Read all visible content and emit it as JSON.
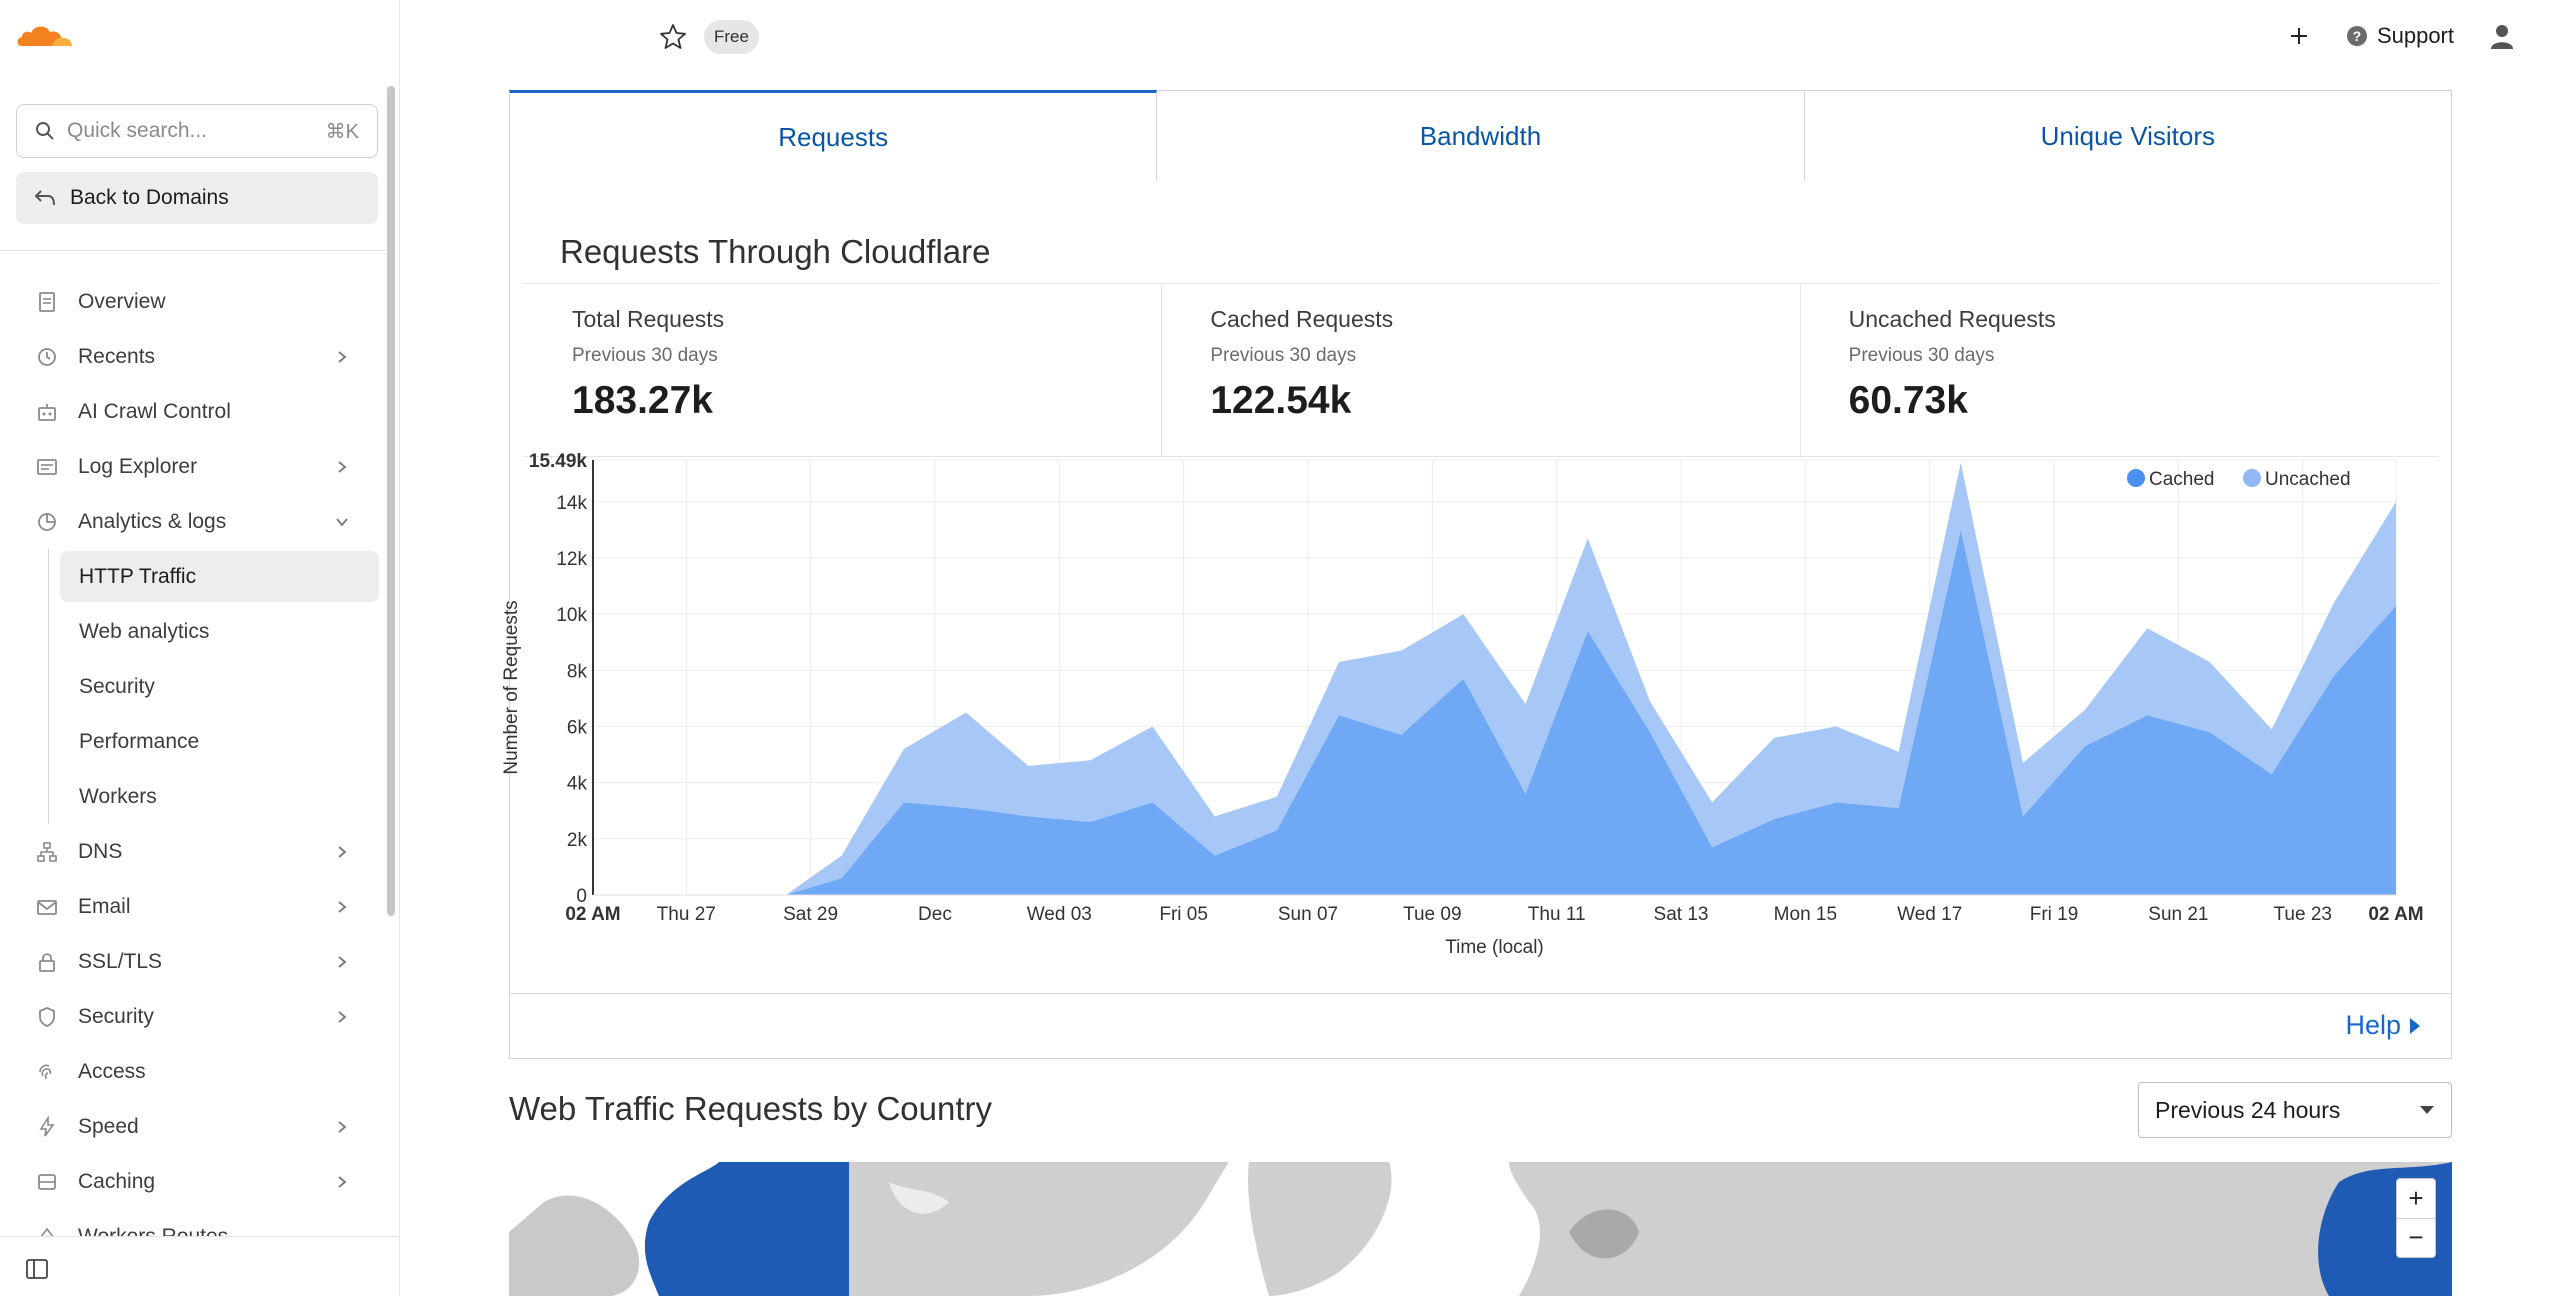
{
  "header": {
    "plan_badge": "Free",
    "support_label": "Support"
  },
  "sidebar": {
    "search_placeholder": "Quick search...",
    "search_shortcut": "⌘K",
    "back_label": "Back to Domains",
    "items": [
      {
        "label": "Overview",
        "icon": "document-icon",
        "chevron": false
      },
      {
        "label": "Recents",
        "icon": "clock-icon",
        "chevron": true
      },
      {
        "label": "AI Crawl Control",
        "icon": "robot-icon",
        "chevron": false
      },
      {
        "label": "Log Explorer",
        "icon": "log-icon",
        "chevron": true
      },
      {
        "label": "Analytics & logs",
        "icon": "pie-chart-icon",
        "chevron": true,
        "expanded": true
      }
    ],
    "sub_items": [
      {
        "label": "HTTP Traffic",
        "active": true
      },
      {
        "label": "Web analytics"
      },
      {
        "label": "Security"
      },
      {
        "label": "Performance"
      },
      {
        "label": "Workers"
      }
    ],
    "items_after": [
      {
        "label": "DNS",
        "icon": "network-icon",
        "chevron": true
      },
      {
        "label": "Email",
        "icon": "envelope-icon",
        "chevron": true
      },
      {
        "label": "SSL/TLS",
        "icon": "lock-icon",
        "chevron": true
      },
      {
        "label": "Security",
        "icon": "shield-icon",
        "chevron": true
      },
      {
        "label": "Access",
        "icon": "access-icon",
        "chevron": false
      },
      {
        "label": "Speed",
        "icon": "lightning-icon",
        "chevron": true
      },
      {
        "label": "Caching",
        "icon": "cache-icon",
        "chevron": true
      },
      {
        "label": "Workers Routes",
        "icon": "workers-icon",
        "chevron": false
      }
    ]
  },
  "tabs": [
    {
      "label": "Requests",
      "active": true
    },
    {
      "label": "Bandwidth"
    },
    {
      "label": "Unique Visitors"
    }
  ],
  "card": {
    "title": "Requests Through Cloudflare",
    "stats": [
      {
        "label": "Total Requests",
        "sub": "Previous 30 days",
        "value": "183.27k"
      },
      {
        "label": "Cached Requests",
        "sub": "Previous 30 days",
        "value": "122.54k"
      },
      {
        "label": "Uncached Requests",
        "sub": "Previous 30 days",
        "value": "60.73k"
      }
    ],
    "help_label": "Help"
  },
  "chart_data": {
    "type": "area",
    "xlabel": "Time (local)",
    "ylabel": "Number of Requests",
    "ylim": [
      0,
      15490
    ],
    "y_ticks": [
      "0",
      "2k",
      "4k",
      "6k",
      "8k",
      "10k",
      "12k",
      "14k",
      "15.49k"
    ],
    "y_tick_values": [
      0,
      2000,
      4000,
      6000,
      8000,
      10000,
      12000,
      14000,
      15490
    ],
    "x_ticks": [
      "02 AM",
      "Thu 27",
      "Sat 29",
      "Dec",
      "Wed 03",
      "Fri 05",
      "Sun 07",
      "Tue 09",
      "Thu 11",
      "Sat 13",
      "Mon 15",
      "Wed 17",
      "Fri 19",
      "Sun 21",
      "Tue 23",
      "02 AM"
    ],
    "x_tick_positions": [
      0,
      1.5,
      3.5,
      5.5,
      7.5,
      9.5,
      11.5,
      13.5,
      15.5,
      17.5,
      19.5,
      21.5,
      23.5,
      25.5,
      27.5,
      29
    ],
    "xlim": [
      0,
      29
    ],
    "x": [
      0,
      1,
      2,
      3,
      3.1,
      4,
      5,
      6,
      7,
      8,
      9,
      10,
      11,
      12,
      13,
      14,
      15,
      16,
      17,
      18,
      19,
      20,
      21,
      22,
      23,
      24,
      25,
      26,
      27,
      28,
      29
    ],
    "legend": {
      "placement": "top-right"
    },
    "series": [
      {
        "name": "Cached",
        "color": "#6fa8f5",
        "values": [
          0,
          0,
          0,
          0,
          0,
          600,
          3300,
          3100,
          2800,
          2600,
          3300,
          1400,
          2300,
          6400,
          5700,
          7700,
          3600,
          9400,
          5800,
          1700,
          2700,
          3300,
          3100,
          13000,
          2800,
          5300,
          6400,
          5800,
          4300,
          7800,
          10300
        ]
      },
      {
        "name": "Uncached",
        "color": "#a7c8f6",
        "values": [
          0,
          0,
          0,
          0,
          0,
          800,
          1900,
          3400,
          1800,
          2200,
          2700,
          1400,
          1200,
          1900,
          3000,
          2300,
          3200,
          3300,
          1100,
          1600,
          2900,
          2700,
          2000,
          2400,
          1900,
          1300,
          3100,
          2500,
          1600,
          2600,
          3700
        ]
      }
    ]
  },
  "country_section": {
    "title": "Web Traffic Requests by Country",
    "range": "Previous 24 hours",
    "zoom_in": "+",
    "zoom_out": "−"
  }
}
